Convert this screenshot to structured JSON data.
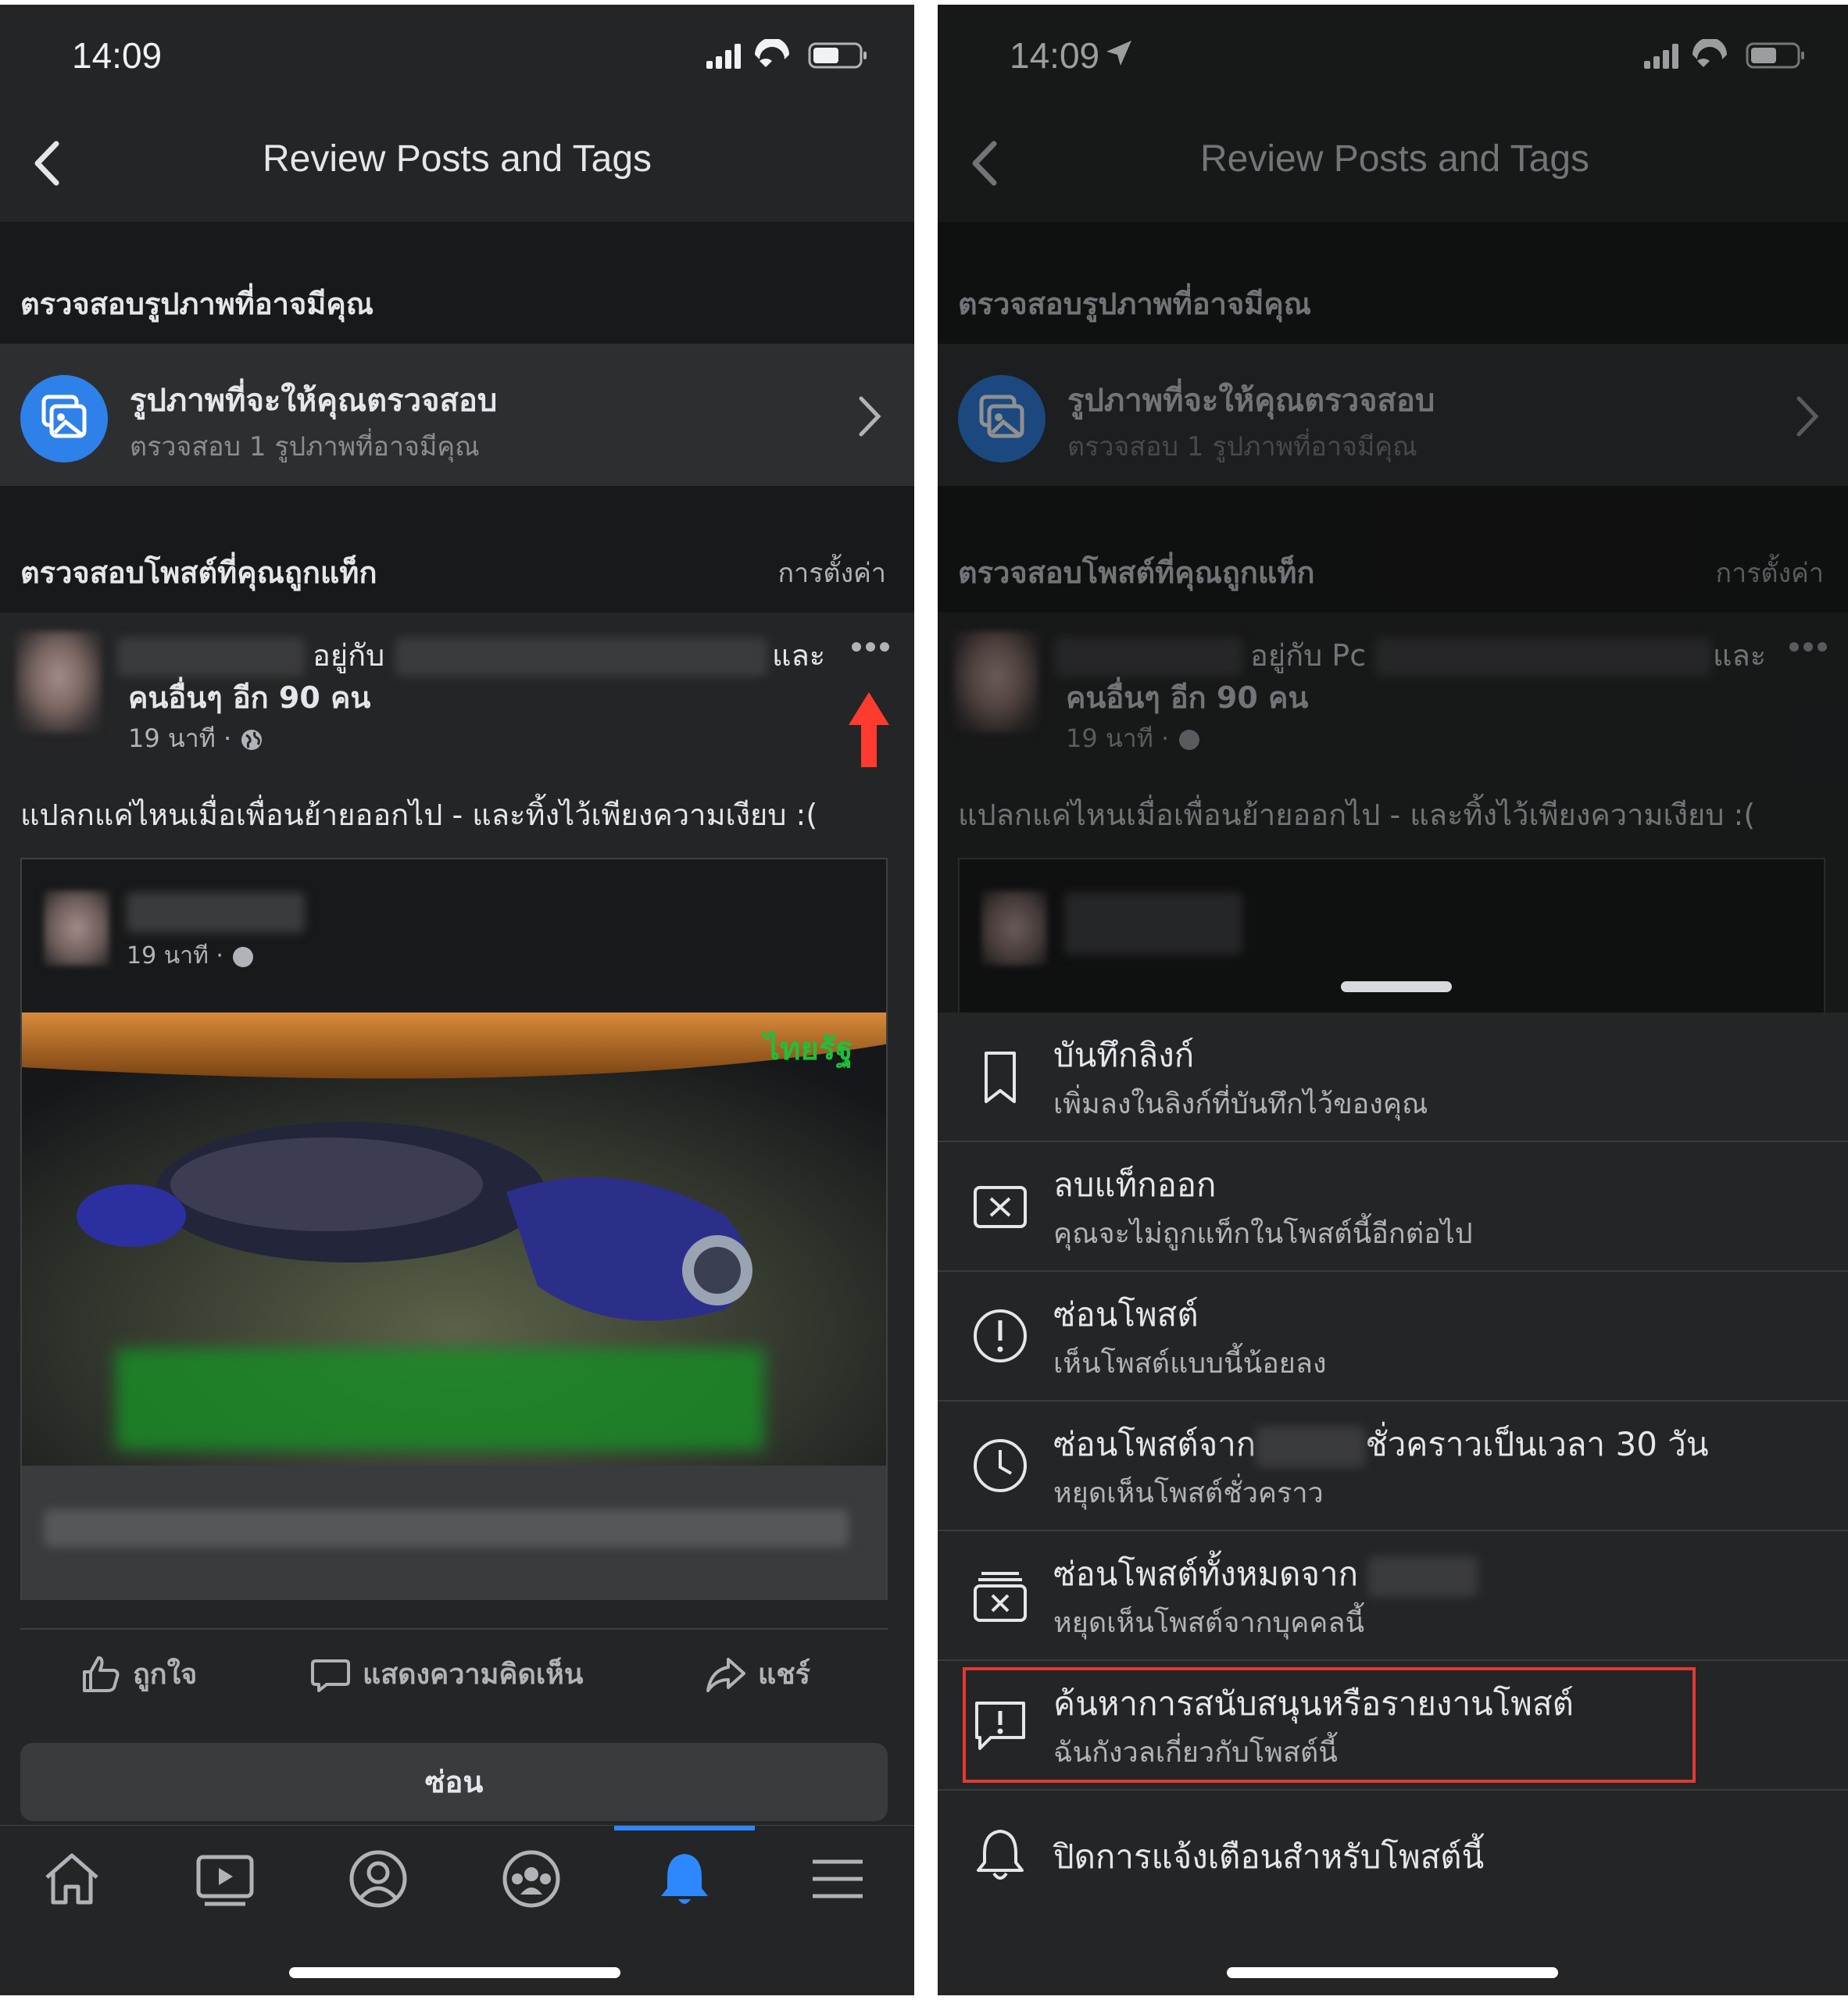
{
  "status_bar": {
    "time": "14:09"
  },
  "header": {
    "title": "Review Posts and Tags"
  },
  "photo_review": {
    "section_title": "ตรวจสอบรูปภาพที่อาจมีคุณ",
    "row_title": "รูปภาพที่จะให้คุณตรวจสอบ",
    "row_subtitle": "ตรวจสอบ 1 รูปภาพที่อาจมีคุณ"
  },
  "tagged_posts": {
    "section_title": "ตรวจสอบโพสต์ที่คุณถูกแท็ก",
    "settings_label": "การตั้งค่า"
  },
  "post": {
    "with_label": "อยู่กับ",
    "with_label_right": "อยู่กับ Pc",
    "and_label": "และ",
    "others_label": "คนอื่นๆ อีก 90 คน",
    "time": "19 นาที ·",
    "text": "แปลกแค่ไหนเมื่อเพื่อนย้ายออกไป - และทิ้งไว้เพียงความเงียบ :(",
    "shared_time": "19 นาที ·",
    "watermark": "ไทยรัฐ",
    "actions": {
      "like": "ถูกใจ",
      "comment": "แสดงความคิดเห็น",
      "share": "แชร์"
    },
    "hide_button": "ซ่อน"
  },
  "tab_bar": {
    "tabs": [
      "home-icon",
      "video-icon",
      "profile-icon",
      "groups-icon",
      "notifications-icon",
      "menu-icon"
    ],
    "active": "notifications-icon"
  },
  "menu": {
    "items": [
      {
        "icon": "bookmark-icon",
        "title": "บันทึกลิงก์",
        "subtitle": "เพิ่มลงในลิงก์ที่บันทึกไว้ของคุณ"
      },
      {
        "icon": "remove-tag-icon",
        "title": "ลบแท็กออก",
        "subtitle": "คุณจะไม่ถูกแท็กในโพสต์นี้อีกต่อไป"
      },
      {
        "icon": "alert-icon",
        "title": "ซ่อนโพสต์",
        "subtitle": "เห็นโพสต์แบบนี้น้อยลง"
      },
      {
        "icon": "clock-icon",
        "title_prefix": "ซ่อนโพสต์จาก",
        "title_suffix": "ชั่วคราวเป็นเวลา 30 วัน",
        "subtitle": "หยุดเห็นโพสต์ชั่วคราว"
      },
      {
        "icon": "unfollow-icon",
        "title": "ซ่อนโพสต์ทั้งหมดจาก",
        "subtitle": "หยุดเห็นโพสต์จากบุคคลนี้"
      },
      {
        "icon": "report-icon",
        "title": "ค้นหาการสนับสนุนหรือรายงานโพสต์",
        "subtitle": "ฉันกังวลเกี่ยวกับโพสต์นี้",
        "highlighted": true
      },
      {
        "icon": "bell-icon",
        "title": "ปิดการแจ้งเตือนสำหรับโพสต์นี้"
      }
    ]
  },
  "colors": {
    "background": "#18191a",
    "surface": "#242526",
    "accent": "#2d88ff",
    "highlight": "#e03a32",
    "arrow": "#ff3b30"
  }
}
